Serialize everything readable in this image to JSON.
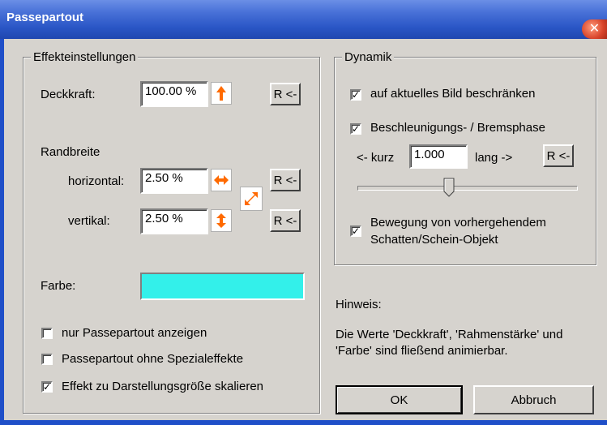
{
  "window": {
    "title": "Passepartout"
  },
  "effekt": {
    "legend": "Effekteinstellungen",
    "deckkraft_label": "Deckkraft:",
    "deckkraft_value": "100.00 %",
    "reset_label": "R <-",
    "randbreite_label": "Randbreite",
    "horizontal_label": "horizontal:",
    "horizontal_value": "2.50 %",
    "vertikal_label": "vertikal:",
    "vertikal_value": "2.50 %",
    "farbe_label": "Farbe:",
    "farbe_color": "#33f0ea",
    "cb_nur_label": "nur Passepartout anzeigen",
    "cb_nur_checked": false,
    "cb_ohne_label": "Passepartout ohne Spezialeffekte",
    "cb_ohne_checked": false,
    "cb_skalieren_label": "Effekt zu Darstellungsgröße skalieren",
    "cb_skalieren_checked": true
  },
  "dynamik": {
    "legend": "Dynamik",
    "cb_bild_label": "auf aktuelles Bild beschränken",
    "cb_bild_checked": true,
    "cb_phase_label": "Beschleunigungs- / Bremsphase",
    "cb_phase_checked": true,
    "kurz_label": "<- kurz",
    "kurz_value": "1.000",
    "lang_label": "lang ->",
    "reset_label": "R <-",
    "slider_value": 0.42,
    "cb_bewegung_label_1": "Bewegung von vorhergehendem",
    "cb_bewegung_label_2": "Schatten/Schein-Objekt",
    "cb_bewegung_checked": true
  },
  "hinweis": {
    "title": "Hinweis:",
    "line1": "Die Werte 'Deckkraft', 'Rahmenstärke' und",
    "line2": "'Farbe' sind fließend animierbar."
  },
  "buttons": {
    "ok": "OK",
    "cancel": "Abbruch"
  },
  "icons": {
    "accent": "#ff6a00"
  }
}
